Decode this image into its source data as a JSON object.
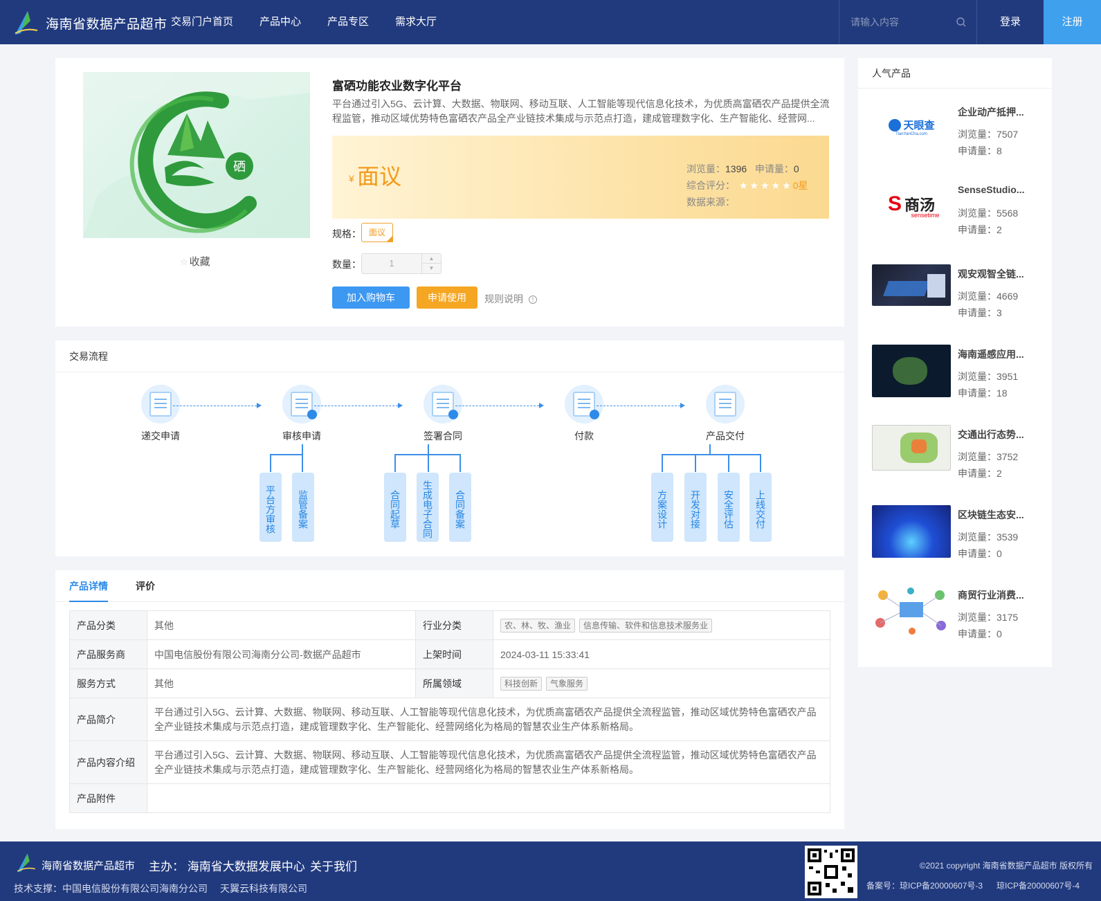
{
  "header": {
    "site_title": "海南省数据产品超市",
    "nav": [
      "交易门户首页",
      "产品中心",
      "产品专区",
      "需求大厅"
    ],
    "search_placeholder": "请输入内容",
    "login": "登录",
    "register": "注册"
  },
  "product": {
    "title": "富硒功能农业数字化平台",
    "description": "平台通过引入5G、云计算、大数据、物联网、移动互联、人工智能等现代信息化技术，为优质高富硒农产品提供全流程监管，推动区域优势特色富硒农产品全产业链技术集成与示范点打造，建成管理数字化、生产智能化、经营网...",
    "price_symbol": "¥",
    "price": "面议",
    "views_label": "浏览量：",
    "views": "1396",
    "applies_label": "申请量：",
    "applies": "0",
    "rating_label": "综合评分：",
    "stars": "★★★★★",
    "rating": "0星",
    "source_label": "数据来源：",
    "favorite": "收藏",
    "spec_label": "规格：",
    "spec_value": "面议",
    "qty_label": "数量：",
    "qty_value": "1",
    "add_cart": "加入购物车",
    "apply": "申请使用",
    "rules": "规则说明",
    "logo_char": "硒"
  },
  "flow": {
    "title": "交易流程",
    "steps": [
      "递交申请",
      "审核申请",
      "签署合同",
      "付款",
      "产品交付"
    ],
    "sub": {
      "review": [
        "平台方审核",
        "监管备案"
      ],
      "contract": [
        "合同起草",
        "生成电子合同",
        "合同备案"
      ],
      "delivery": [
        "方案设计",
        "开发对接",
        "安全评估",
        "上线交付"
      ]
    }
  },
  "detail": {
    "tabs": [
      "产品详情",
      "评价"
    ],
    "rows": {
      "category_k": "产品分类",
      "category_v": "其他",
      "industry_k": "行业分类",
      "industry_tags": [
        "农、林、牧、渔业",
        "信息传输、软件和信息技术服务业"
      ],
      "provider_k": "产品服务商",
      "provider_v": "中国电信股份有限公司海南分公司-数据产品超市",
      "time_k": "上架时间",
      "time_v": "2024-03-11 15:33:41",
      "service_k": "服务方式",
      "service_v": "其他",
      "domain_k": "所属领域",
      "domain_tags": [
        "科技创新",
        "气象服务"
      ],
      "intro_k": "产品简介",
      "intro_v": "平台通过引入5G、云计算、大数据、物联网、移动互联、人工智能等现代信息化技术，为优质高富硒农产品提供全流程监管，推动区域优势特色富硒农产品全产业链技术集成与示范点打造，建成管理数字化、生产智能化、经营网络化为格局的智慧农业生产体系新格局。",
      "content_k": "产品内容介绍",
      "content_v": "平台通过引入5G、云计算、大数据、物联网、移动互联、人工智能等现代信息化技术，为优质高富硒农产品提供全流程监管，推动区域优势特色富硒农产品全产业链技术集成与示范点打造，建成管理数字化、生产智能化、经营网络化为格局的智慧农业生产体系新格局。",
      "attach_k": "产品附件"
    }
  },
  "sidebar": {
    "title": "人气产品",
    "views_label": "浏览量：",
    "applies_label": "申请量：",
    "items": [
      {
        "name": "企业动产抵押...",
        "views": "7507",
        "applies": "8",
        "logo": "天眼查",
        "logo_sub": "TianYanCha.com"
      },
      {
        "name": "SenseStudio...",
        "views": "5568",
        "applies": "2",
        "logo": "商汤",
        "logo_sub": "sensetime"
      },
      {
        "name": "观安观智全链...",
        "views": "4669",
        "applies": "3"
      },
      {
        "name": "海南遥感应用...",
        "views": "3951",
        "applies": "18"
      },
      {
        "name": "交通出行态势...",
        "views": "3752",
        "applies": "2"
      },
      {
        "name": "区块链生态安...",
        "views": "3539",
        "applies": "0"
      },
      {
        "name": "商贸行业消费...",
        "views": "3175",
        "applies": "0"
      }
    ]
  },
  "footer": {
    "title": "海南省数据产品超市",
    "host": "主办： 海南省大数据发展中心",
    "about": "关于我们",
    "support": "技术支撑：中国电信股份有限公司海南分公司",
    "support2": "天翼云科技有限公司",
    "copyright": "©2021 copyright 海南省数据产品超市 版权所有",
    "icp1": "备案号：琼ICP备20000607号-3",
    "icp2": "琼ICP备20000607号-4"
  },
  "colors": {
    "header_bg": "#213a7e",
    "accent_blue": "#3d98f1",
    "accent_orange": "#f5a623",
    "register_bg": "#3fa0ee"
  }
}
